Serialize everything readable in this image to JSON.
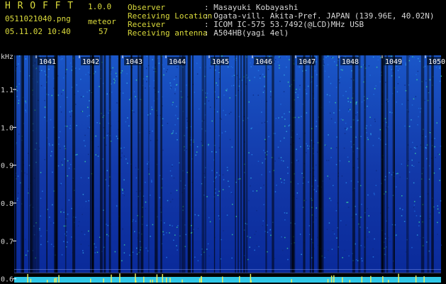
{
  "header": {
    "app_name": "H R O F F T",
    "version": "1.0.0",
    "filename": "0511021040.png",
    "datetime": "05.11.02 10:40",
    "mode_label": "meteor",
    "count": "57"
  },
  "station": [
    {
      "key": "Observer",
      "value": ": Masayuki Kobayashi"
    },
    {
      "key": "Receiving Location",
      "value": ": Ogata-vill. Akita-Pref. JAPAN (139.96E, 40.02N)"
    },
    {
      "key": "Receiver",
      "value": ": ICOM IC-575 53.7492(@LCD)MHz USB"
    },
    {
      "key": "Receiving antenna",
      "value": ": A504HB(yagi 4el)"
    }
  ],
  "colors": {
    "background": "#000000",
    "header_label": "#dcdc3c",
    "header_value": "#d8d8d8",
    "spectrogram_low": "#0a2a9a",
    "spectrogram_high": "#40e0a0",
    "baseline": "#30c8e8",
    "tick_label_bg": "#ffff00"
  },
  "chart_data": {
    "type": "heatmap",
    "title": "",
    "ylabel": "kHz",
    "xlabel": "",
    "x_ticks": [
      "1041",
      "1042",
      "1043",
      "1044",
      "1045",
      "1046",
      "1047",
      "1048",
      "1049",
      "1050"
    ],
    "y_ticks": [
      {
        "value": 1.1,
        "label": "1.1"
      },
      {
        "value": 1.0,
        "label": "1.0"
      },
      {
        "value": 0.9,
        "label": "0.9"
      },
      {
        "value": 0.8,
        "label": "0.8"
      },
      {
        "value": 0.7,
        "label": "0.7"
      },
      {
        "value": 0.6,
        "label": "0.6"
      }
    ],
    "ylim": [
      0.59,
      1.19
    ],
    "grid": false,
    "reference_lines_khz": [
      0.615,
      0.625
    ]
  }
}
